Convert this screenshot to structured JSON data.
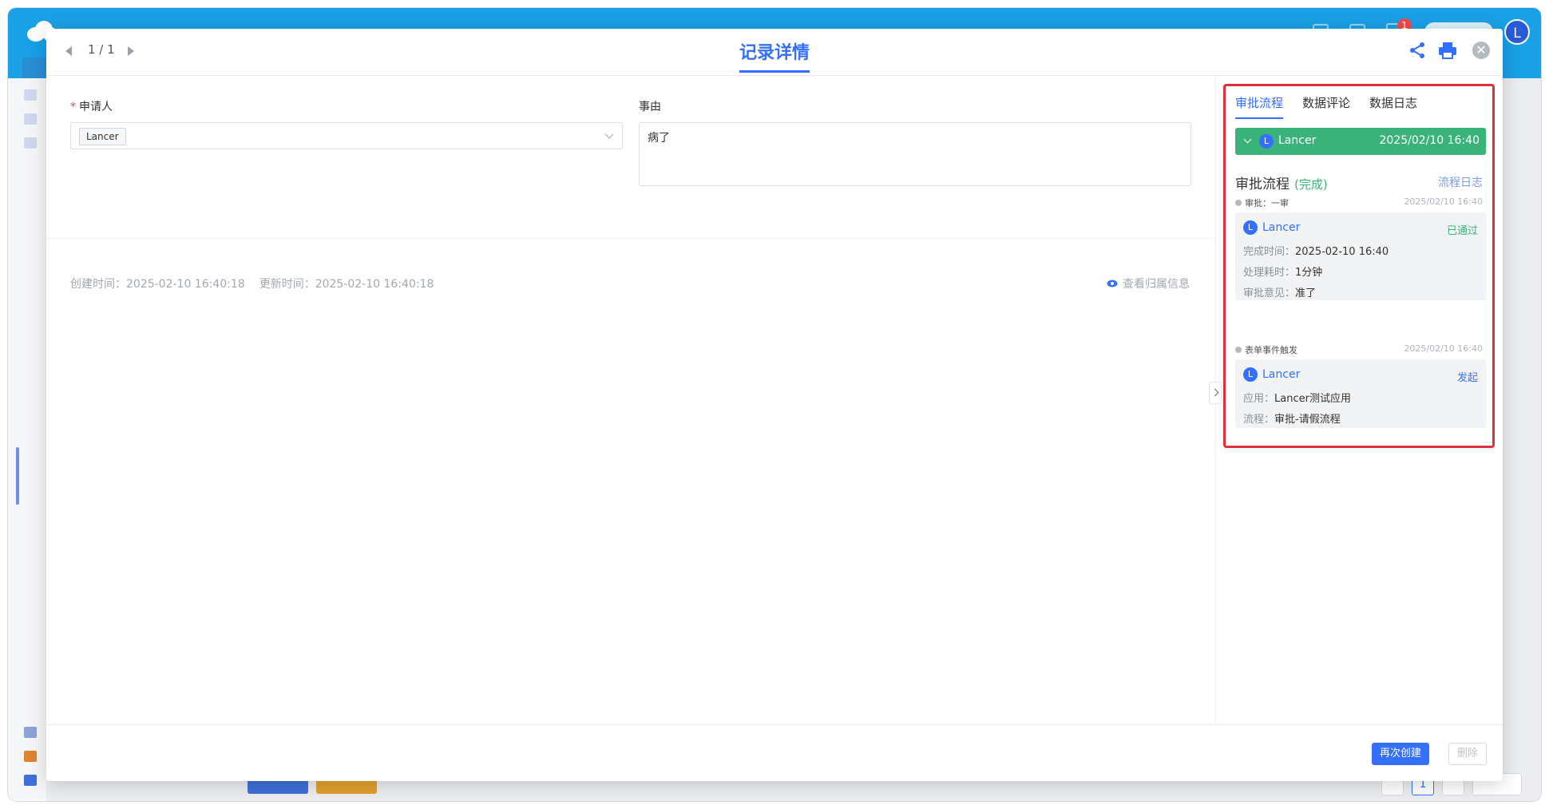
{
  "background_app": {
    "notification_count": "1",
    "user_initial": "L",
    "pager": {
      "current_page": "1"
    }
  },
  "modal": {
    "pager_text": "1 / 1",
    "title": "记录详情",
    "form": {
      "applicant_label": "申请人",
      "applicant_value": "Lancer",
      "reason_label": "事由",
      "reason_value": "病了"
    },
    "meta": {
      "created": "创建时间：2025-02-10 16:40:18",
      "updated": "更新时间：2025-02-10 16:40:18",
      "view_owner": "查看归属信息"
    },
    "footer": {
      "recreate_button": "再次创建",
      "delete_button": "删除"
    }
  },
  "panel": {
    "tabs": [
      {
        "label": "审批流程",
        "active": true
      },
      {
        "label": "数据评论",
        "active": false
      },
      {
        "label": "数据日志",
        "active": false
      }
    ],
    "banner": {
      "avatar": "L",
      "user": "Lancer",
      "time": "2025/02/10 16:40",
      "color": "#3ab37a"
    },
    "flow_title": "审批流程",
    "flow_status": "(完成)",
    "flow_log_link": "流程日志",
    "steps": [
      {
        "name": "审批：一审",
        "time": "2025/02/10 16:40",
        "user_avatar": "L",
        "user": "Lancer",
        "status": "已通过",
        "status_color": "#3ab37a",
        "rows": [
          {
            "k": "完成时间：",
            "v": "2025-02-10 16:40"
          },
          {
            "k": "处理耗时：",
            "v": "1分钟"
          },
          {
            "k": "审批意见：",
            "v": "准了"
          }
        ]
      },
      {
        "name": "表单事件触发",
        "time": "2025/02/10 16:40",
        "user_avatar": "L",
        "user": "Lancer",
        "status": "发起",
        "status_color": "#3370ff",
        "rows": [
          {
            "k": "应用：",
            "v": "Lancer测试应用"
          },
          {
            "k": "流程：",
            "v": "审批-请假流程"
          }
        ]
      }
    ]
  }
}
